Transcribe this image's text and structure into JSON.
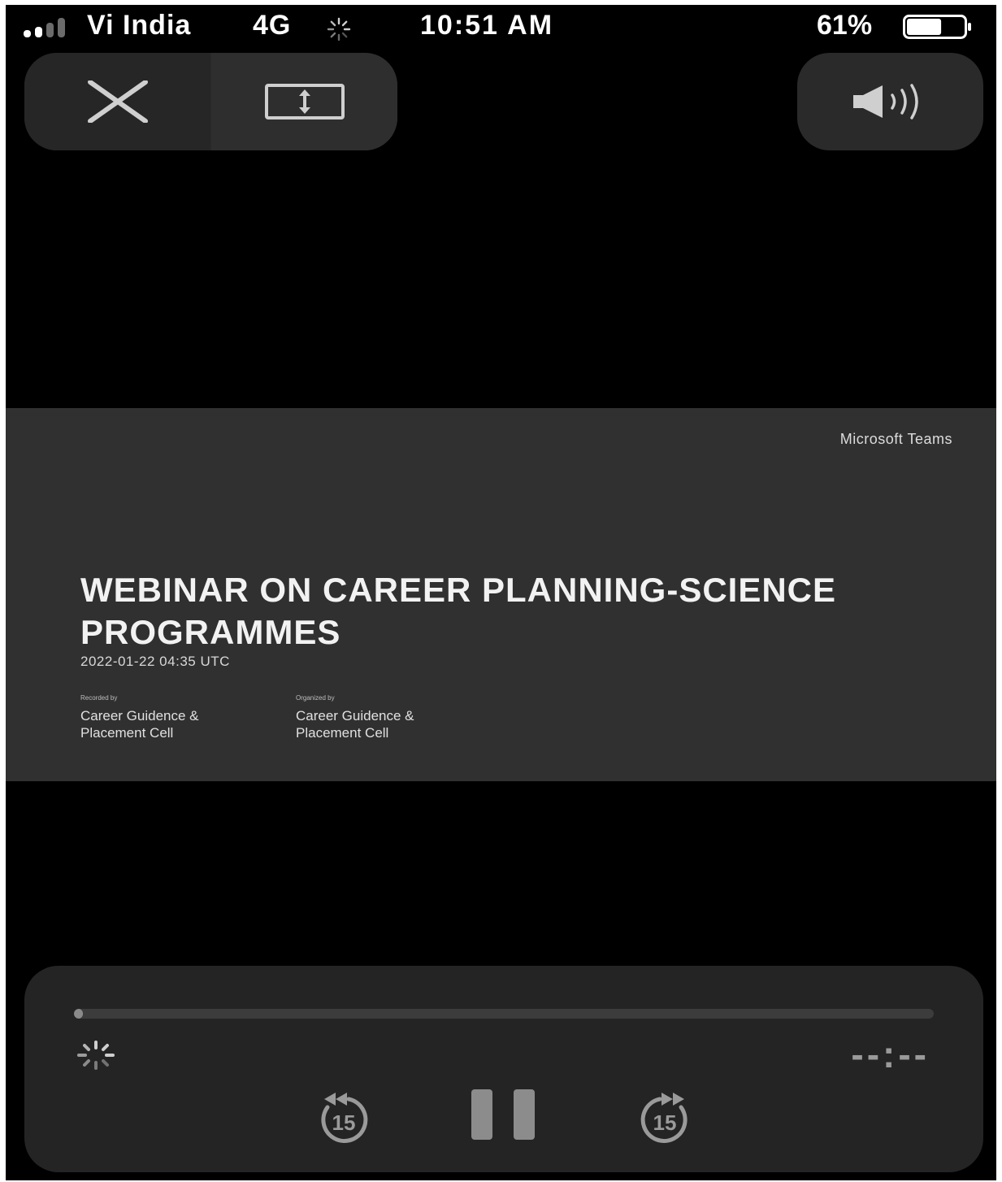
{
  "status_bar": {
    "carrier": "Vi India",
    "network": "4G",
    "time": "10:51 AM",
    "battery_percent": "61%",
    "battery_level": 0.61,
    "signal_bars_filled": 2,
    "signal_bars_total": 4
  },
  "top_controls": {
    "close_icon": "close-icon",
    "resize_icon": "aspect-resize-icon",
    "volume_icon": "speaker-volume-icon"
  },
  "slide": {
    "watermark": "Microsoft Teams",
    "title": "WEBINAR ON CAREER PLANNING-SCIENCE PROGRAMMES",
    "date": "2022-01-22 04:35 UTC",
    "meta": [
      {
        "label": "Recorded by",
        "value": "Career Guidence & Placement Cell"
      },
      {
        "label": "Organized by",
        "value": "Career Guidence & Placement Cell"
      }
    ]
  },
  "player": {
    "progress": 0.01,
    "time_remaining": "--:--",
    "skip_back_seconds": "15",
    "skip_forward_seconds": "15"
  },
  "colors": {
    "background": "#000000",
    "panel": "#242424",
    "slide": "#303030",
    "control_gray": "#8c8c8c"
  }
}
